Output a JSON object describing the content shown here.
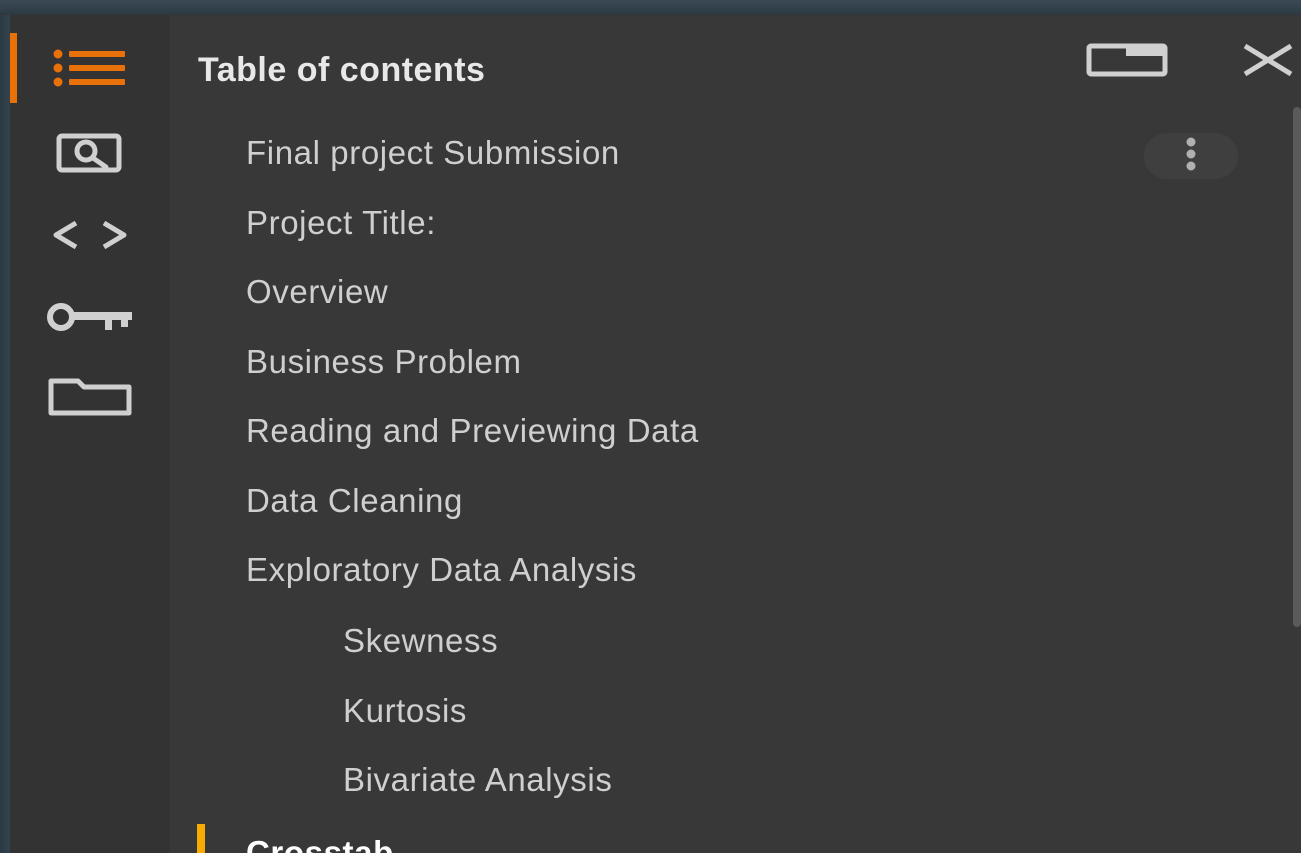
{
  "header": {
    "title": "Table of contents"
  },
  "rail": {
    "items": [
      {
        "name": "table-of-contents",
        "icon": "list-icon",
        "active": true
      },
      {
        "name": "find-and-replace",
        "icon": "search-doc-icon"
      },
      {
        "name": "code-snippets",
        "icon": "code-icon"
      },
      {
        "name": "secrets",
        "icon": "key-icon"
      },
      {
        "name": "files",
        "icon": "folder-icon"
      }
    ]
  },
  "toc": {
    "items": [
      {
        "label": "Final project Submission",
        "level": 1
      },
      {
        "label": "Project Title:",
        "level": 1
      },
      {
        "label": "Overview",
        "level": 1
      },
      {
        "label": "Business Problem",
        "level": 1
      },
      {
        "label": "Reading and Previewing Data",
        "level": 1
      },
      {
        "label": "Data Cleaning",
        "level": 1
      },
      {
        "label": "Exploratory Data Analysis",
        "level": 1
      },
      {
        "label": "Skewness",
        "level": 2
      },
      {
        "label": "Kurtosis",
        "level": 2
      },
      {
        "label": "Bivariate Analysis",
        "level": 2
      },
      {
        "label": "Crosstab",
        "level": 1,
        "active": true
      }
    ]
  },
  "colors": {
    "accent_orange": "#e8710a",
    "active_marker": "#f9ab00",
    "panel_bg": "#383838",
    "rail_bg": "#333333",
    "text": "#cfcfcf"
  }
}
